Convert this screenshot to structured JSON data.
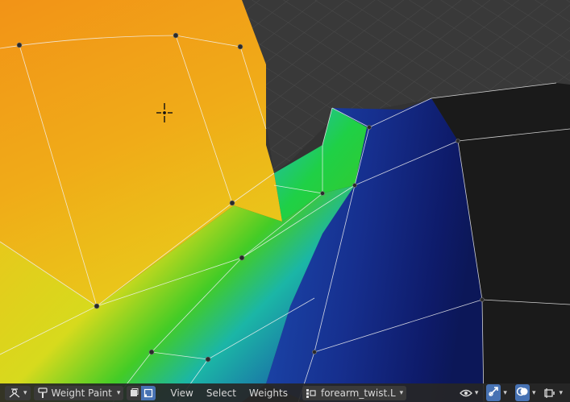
{
  "header": {
    "mode": {
      "label": "Weight Paint",
      "icon": "weight-paint-brush-icon"
    },
    "menus": [
      "View",
      "Select",
      "Weights"
    ],
    "vertex_group": {
      "label": "forearm_twist.L",
      "icon": "vertex-group-icon"
    },
    "colors": {
      "bar_bg": "#262626",
      "button_bg": "#3a3a3a",
      "active_blue": "#4772b3",
      "text": "#d8d8d8"
    }
  },
  "viewport": {
    "cursor_icon": "3d-cursor-icon",
    "weight_colors": [
      "#f39a18",
      "#e6d41c",
      "#2fcf24",
      "#16a5b8",
      "#1b3e9d",
      "#0f1c6e"
    ]
  }
}
